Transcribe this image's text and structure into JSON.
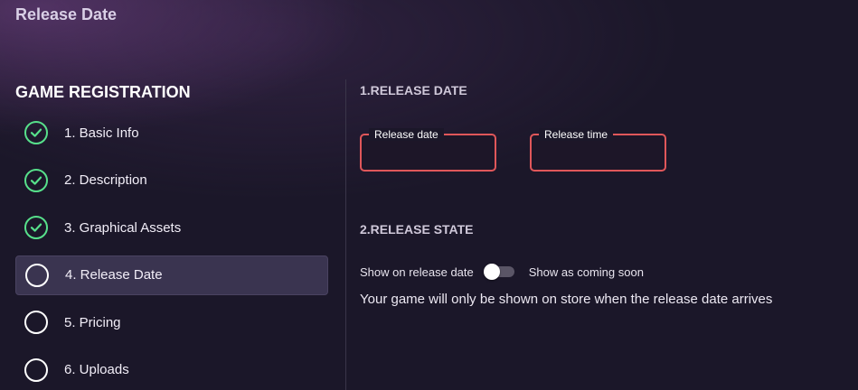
{
  "page": {
    "title": "Release Date"
  },
  "sidebar": {
    "heading": "GAME REGISTRATION",
    "steps": [
      {
        "label": "1. Basic Info",
        "status": "completed"
      },
      {
        "label": "2. Description",
        "status": "completed"
      },
      {
        "label": "3. Graphical Assets",
        "status": "completed"
      },
      {
        "label": "4. Release Date",
        "status": "active"
      },
      {
        "label": "5. Pricing",
        "status": "pending"
      },
      {
        "label": "6. Uploads",
        "status": "pending"
      }
    ]
  },
  "main": {
    "release_date_section": {
      "heading": "1.RELEASE DATE",
      "date_field": {
        "label": "Release date",
        "value": ""
      },
      "time_field": {
        "label": "Release time",
        "value": ""
      }
    },
    "release_state_section": {
      "heading": "2.RELEASE STATE",
      "toggle_left_label": "Show on release date",
      "toggle_right_label": "Show as coming soon",
      "toggle_on": false,
      "info": "Your game will only be shown on store when the release date arrives"
    }
  },
  "colors": {
    "background": "#1b1729",
    "completed": "#57e08b",
    "error_border": "#e0575a",
    "active_step_bg": "#3a3450"
  }
}
